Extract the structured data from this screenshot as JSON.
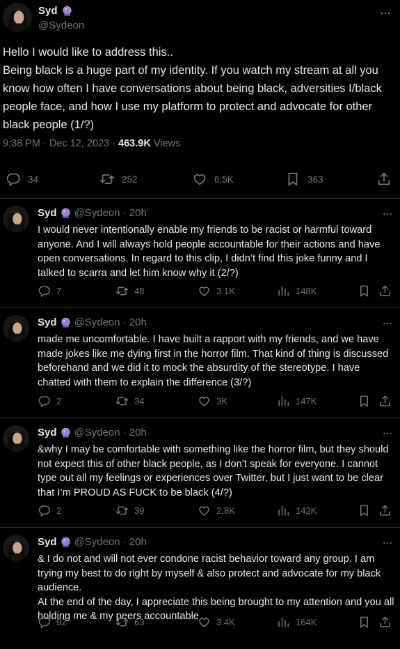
{
  "main_tweet": {
    "author": "Syd",
    "handle": "@Sydeon",
    "text": "Hello I would like to address this.. \nBeing black is a huge part of my identity. If you watch my stream at all you know how often I have conversations about being black, adversities I/black people face, and how I use my platform to protect and advocate for other black people (1/?)",
    "time": "9:38 PM · Dec 12, 2023 · ",
    "views_count": "463.9K",
    "views_label": " Views",
    "replies": "34",
    "reposts": "252",
    "likes": "6.5K",
    "bookmarks": "363"
  },
  "replies": [
    {
      "author": "Syd",
      "handle": "@Sydeon",
      "time": "· 20h",
      "text": "I would never intentionally enable my friends to be racist or harmful toward anyone. And I will always hold people accountable for their actions and have open conversations. In regard to this clip, I didn’t find this joke funny and I talked to scarra and let him know why it (2/?)",
      "replies": "7",
      "reposts": "48",
      "likes": "3.1K",
      "views": "148K"
    },
    {
      "author": "Syd",
      "handle": "@Sydeon",
      "time": "· 20h",
      "text": "made me uncomfortable. I have built a rapport with my friends, and we have made jokes like me dying first in the horror film. That kind of thing is discussed beforehand and we did it to mock the absurdity of the stereotype. I have chatted with them to explain the difference (3/?)",
      "replies": "2",
      "reposts": "34",
      "likes": "3K",
      "views": "147K"
    },
    {
      "author": "Syd",
      "handle": "@Sydeon",
      "time": "· 20h",
      "text": "&why I may be comfortable with something like the horror film, but they should not expect this of other black people, as I don’t speak for everyone. I cannot type out all my feelings or experiences over Twitter, but I just want to be clear that I’m PROUD AS FUCK to be black (4/?)",
      "replies": "2",
      "reposts": "39",
      "likes": "2.8K",
      "views": "142K"
    },
    {
      "author": "Syd",
      "handle": "@Sydeon",
      "time": "· 20h",
      "text": "& I do not and will not ever condone racist behavior toward any group. I am trying my best to do right by myself & also protect and advocate for my black audience.\nAt the end of the day, I appreciate this being brought to my attention and you all holding me & my peers accountable",
      "replies": "92",
      "reposts": "63",
      "likes": "3.4K",
      "views": "164K"
    }
  ],
  "colors": {
    "background": "#000000",
    "text": "#e7e9ea",
    "muted": "#71767b",
    "divider": "#2f3336",
    "badge": "#9c7fd6"
  },
  "icons": [
    "more-icon",
    "crystal-ball-badge-icon",
    "reply-icon",
    "repost-icon",
    "like-icon",
    "views-icon",
    "bookmark-icon",
    "share-icon"
  ]
}
